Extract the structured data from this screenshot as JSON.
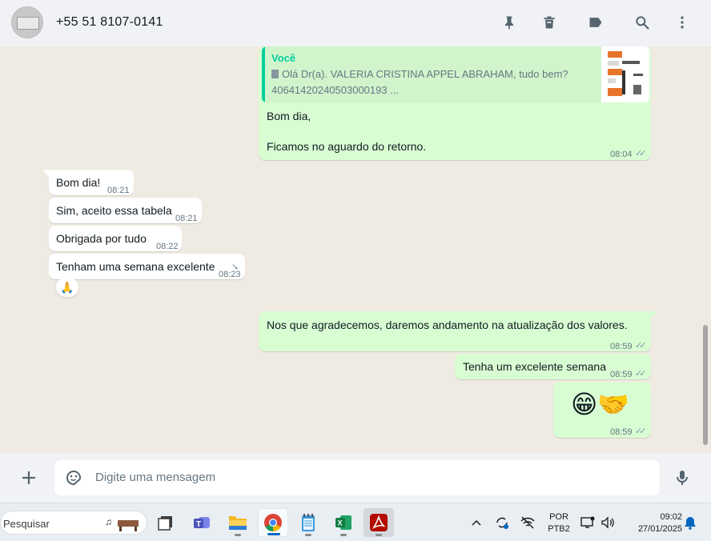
{
  "header": {
    "contact_name": "+55 51 8107-0141",
    "icons": [
      "pin-icon",
      "delete-icon",
      "label-icon",
      "search-icon",
      "menu-icon"
    ]
  },
  "messages": {
    "quote": {
      "author": "Você",
      "line1": "Olá Dr(a). VALERIA CRISTINA APPEL ABRAHAM, tudo bem?",
      "line2": "40641420240503000193 ..."
    },
    "m1": {
      "line1": "Bom dia,",
      "line2": "Ficamos no aguardo do retorno.",
      "time": "08:04"
    },
    "m2": {
      "text": "Bom dia!",
      "time": "08:21"
    },
    "m3": {
      "text": "Sim, aceito essa tabela",
      "time": "08:21"
    },
    "m4": {
      "text": "Obrigada por tudo",
      "time": "08:22"
    },
    "m5": {
      "text": "Tenham uma semana excelente",
      "time": "08:23",
      "reaction": "🙏"
    },
    "m6": {
      "text": "Nos que agradecemos, daremos andamento na atualização dos valores.",
      "time": "08:59"
    },
    "m7": {
      "text": "Tenha um excelente semana",
      "time": "08:59"
    },
    "m8": {
      "text": "😁🤝",
      "time": "08:59"
    }
  },
  "composer": {
    "placeholder": "Digite uma mensagem"
  },
  "taskbar": {
    "search_text": "Pesquisar",
    "lang_line1": "POR",
    "lang_line2": "PTB2",
    "time": "09:02",
    "date": "27/01/2025"
  },
  "colors": {
    "outgoing_bubble": "#d9fdd3",
    "incoming_bubble": "#ffffff",
    "chat_bg": "#efeae2",
    "accent": "#06cf9c"
  }
}
